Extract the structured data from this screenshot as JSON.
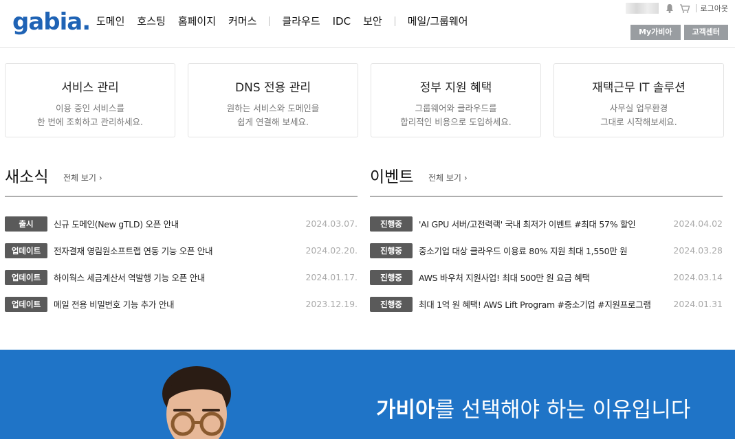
{
  "header": {
    "logo": "gabia",
    "logo_dot": ".",
    "nav": [
      "도메인",
      "호스팅",
      "홈페이지",
      "커머스",
      "클라우드",
      "IDC",
      "보안",
      "메일/그룹웨어"
    ],
    "logout": "로그아웃",
    "my_gabia": "My가비아",
    "support": "고객센터"
  },
  "cards": [
    {
      "title": "서비스 관리",
      "desc1": "이용 중인 서비스를",
      "desc2": "한 번에 조회하고 관리하세요."
    },
    {
      "title": "DNS 전용 관리",
      "desc1": "원하는 서비스와 도메인을",
      "desc2": "쉽게 연결해 보세요."
    },
    {
      "title": "정부 지원 혜택",
      "desc1": "그룹웨어와 클라우드를",
      "desc2": "합리적인 비용으로 도입하세요."
    },
    {
      "title": "재택근무 IT 솔루션",
      "desc1": "사무실 업무환경",
      "desc2": "그대로 시작해보세요."
    }
  ],
  "news": {
    "title": "새소식",
    "more": "전체 보기",
    "items": [
      {
        "badge": "출시",
        "title": "신규 도메인(New gTLD) 오픈 안내",
        "date": "2024.03.07."
      },
      {
        "badge": "업데이트",
        "title": "전자결재 영림원소프트랩 연동 기능 오픈 안내",
        "date": "2024.02.20."
      },
      {
        "badge": "업데이트",
        "title": "하이웍스 세금계산서 역발행 기능 오픈 안내",
        "date": "2024.01.17."
      },
      {
        "badge": "업데이트",
        "title": "메일 전용 비밀번호 기능 추가 안내",
        "date": "2023.12.19."
      }
    ]
  },
  "events": {
    "title": "이벤트",
    "more": "전체 보기",
    "items": [
      {
        "badge": "진행중",
        "title": "'AI GPU 서버/고전력랙' 국내 최저가 이벤트 #최대 57% 할인",
        "date": "2024.04.02"
      },
      {
        "badge": "진행중",
        "title": "중소기업 대상 클라우드 이용료 80% 지원 최대 1,550만 원",
        "date": "2024.03.28"
      },
      {
        "badge": "진행중",
        "title": "AWS 바우처 지원사업! 최대 500만 원 요금 혜택",
        "date": "2024.03.14"
      },
      {
        "badge": "진행중",
        "title": "최대 1억 원 혜택! AWS Lift Program #중소기업 #지원프로그램",
        "date": "2024.01.31"
      }
    ]
  },
  "banner": {
    "brand": "가비아",
    "text": "를 선택해야 하는 이유입니다"
  },
  "colors": {
    "brand": "#1f63b5",
    "banner": "#1f74c7",
    "badge": "#5a5a5a"
  }
}
